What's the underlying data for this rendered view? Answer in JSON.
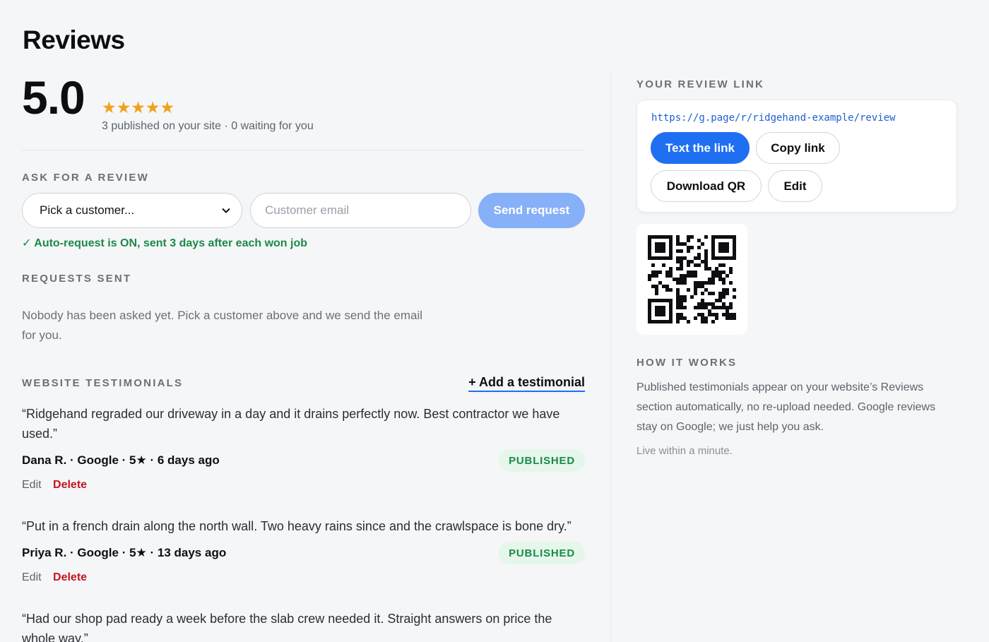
{
  "header": {
    "title": "Reviews"
  },
  "rating": {
    "score": "5.0",
    "stars": "★★★★★",
    "summary": "3 published on your site · 0 waiting for you"
  },
  "ask": {
    "section_label": "ASK FOR A REVIEW",
    "customer_select": "Pick a customer...",
    "email_placeholder": "Customer email",
    "send_label": "Send request",
    "auto_note": "✓ Auto-request is ON, sent 3 days after each won job"
  },
  "requests": {
    "section_label": "REQUESTS SENT",
    "empty_text": "Nobody has been asked yet. Pick a customer above and we send the email for you."
  },
  "testimonials": {
    "section_label": "WEBSITE TESTIMONIALS",
    "add_label": "+ Add a testimonial",
    "edit_label": "Edit",
    "delete_label": "Delete",
    "items": [
      {
        "quote": "“Ridgehand regraded our driveway in a day and it drains perfectly now. Best contractor we have used.”",
        "meta": "Dana R. · Google · 5★ · 6 days ago",
        "status": "PUBLISHED"
      },
      {
        "quote": "“Put in a french drain along the north wall. Two heavy rains since and the crawlspace is bone dry.”",
        "meta": "Priya R. · Google · 5★ · 13 days ago",
        "status": "PUBLISHED"
      },
      {
        "quote": "“Had our shop pad ready a week before the slab crew needed it. Straight answers on price the whole way.”"
      }
    ]
  },
  "review_link": {
    "section_label": "YOUR REVIEW LINK",
    "url": "https://g.page/r/ridgehand-example/review",
    "text_link_label": "Text the link",
    "copy_link_label": "Copy link",
    "download_qr_label": "Download QR",
    "edit_label": "Edit"
  },
  "how_it_works": {
    "section_label": "HOW IT WORKS",
    "body": "Published testimonials appear on your website’s Reviews section automatically, no re-upload needed. Google reviews stay on Google; we just help you ask.",
    "footnote": "Live within a minute."
  },
  "colors": {
    "accent": "#1f6ff2",
    "send_disabled": "#86b0f7",
    "star": "#f2a019",
    "success": "#1a8a4a",
    "danger": "#c4161c"
  }
}
